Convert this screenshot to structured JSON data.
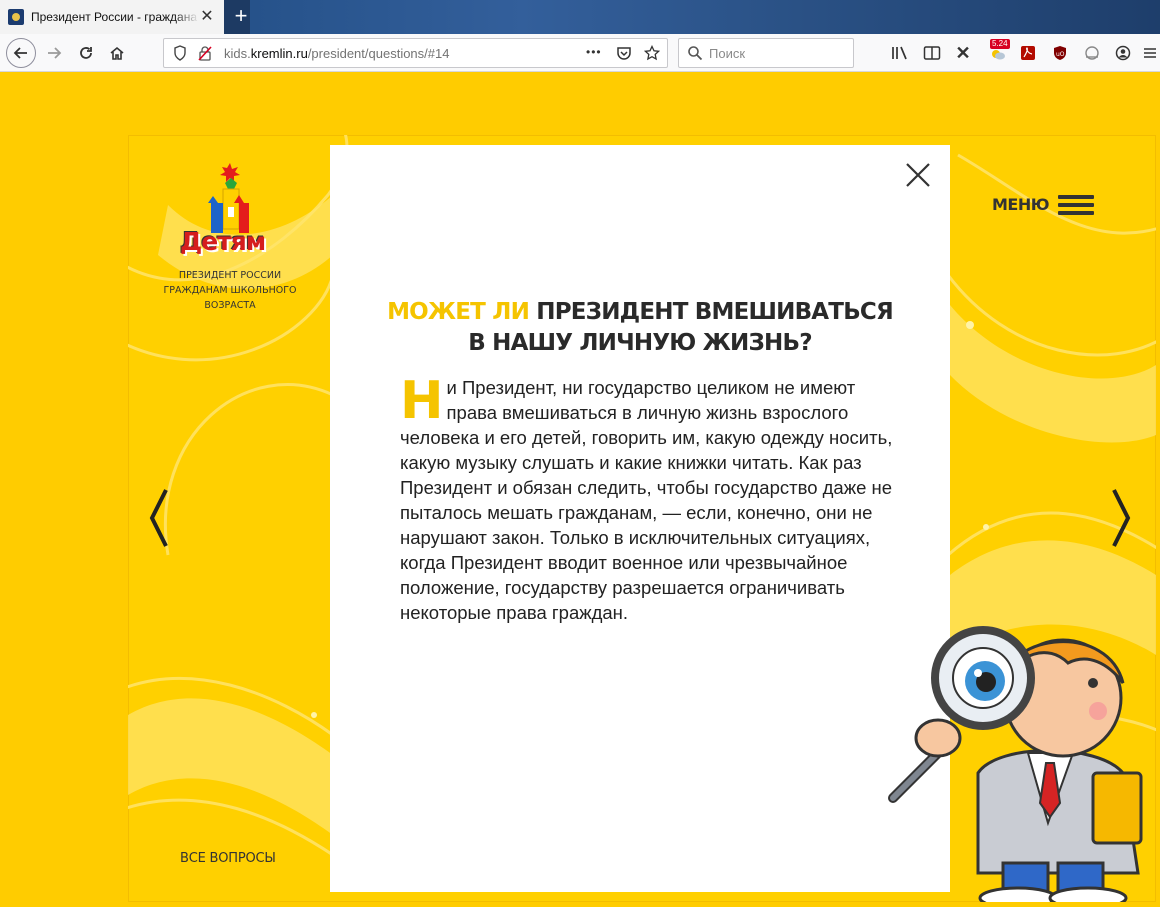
{
  "browser": {
    "tab_title": "Президент России - граждана",
    "tab_close": "✕",
    "new_tab": "+",
    "url_prefix": "kids.",
    "url_host": "kremlin.ru",
    "url_path": "/president/questions/#14",
    "url_more": "•••",
    "search_placeholder": "Поиск",
    "badge": "5.24"
  },
  "sidebar": {
    "logo_text": "Детям",
    "caption": "ПРЕЗИДЕНТ РОССИИ ГРАЖДАНАМ ШКОЛЬНОГО ВОЗРАСТА",
    "all_questions": "ВСЕ ВОПРОСЫ"
  },
  "header": {
    "menu_label": "МЕНЮ"
  },
  "question": {
    "title_highlight": "МОЖЕТ ЛИ",
    "title_rest_line1": " ПРЕЗИДЕНТ ВМЕШИВАТЬСЯ",
    "title_line2": "В НАШУ ЛИЧНУЮ ЖИЗНЬ?",
    "answer_initial": "Н",
    "answer_text": "и Президент, ни государство целиком не имеют права вмешиваться в личную жизнь взрослого человека и его детей, говорить им, какую одежду носить, какую музыку слушать и какие книжки читать. Как раз Президент и обязан следить, чтобы государство даже не пыталось мешать гражданам, — если, конечно, они не нарушают закон. Только в исключительных ситуациях, когда Президент вводит военное или чрезвычайное положение, государству разрешается ограничивать некоторые права граждан."
  },
  "colors": {
    "page_bg": "#ffcc00",
    "accent": "#f5c400",
    "text": "#222222",
    "browser_tabbar": "#1d3a63"
  },
  "icons": {
    "back": "arrow-left-icon",
    "forward": "arrow-right-icon",
    "reload": "reload-icon",
    "home": "home-icon",
    "shield": "shield-icon",
    "pocket": "pocket-icon",
    "star": "star-icon",
    "search": "search-icon",
    "library": "library-icon",
    "reader": "reader-view-icon",
    "close_modal": "close-icon",
    "menu": "hamburger-icon",
    "prev": "chevron-left-icon",
    "next": "chevron-right-icon"
  }
}
